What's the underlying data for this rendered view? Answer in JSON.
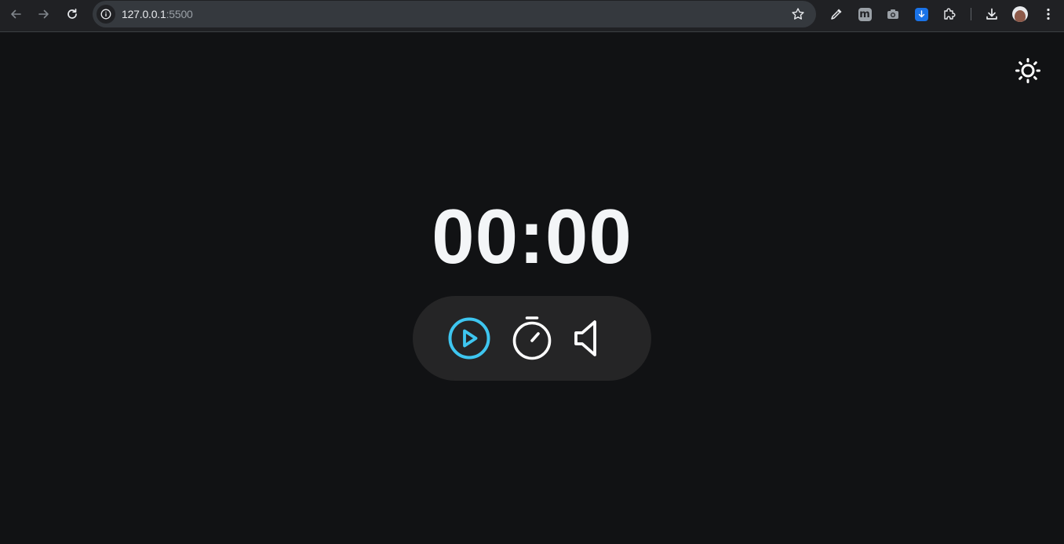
{
  "browser": {
    "url_host": "127.0.0.1",
    "url_port": ":5500",
    "icons": [
      "back-arrow-icon",
      "forward-arrow-icon",
      "reload-icon",
      "site-info-icon",
      "bookmark-star-icon",
      "eyedropper-extension-icon",
      "m-extension-icon",
      "camera-extension-icon",
      "download-extension-icon",
      "extensions-puzzle-icon",
      "downloads-icon",
      "profile-avatar",
      "menu-kebab-icon"
    ],
    "ext_m_letter": "m"
  },
  "app": {
    "timer": "00:00",
    "theme_icon": "sun-icon",
    "controls": [
      "play-icon",
      "stopwatch-icon",
      "volume-icon"
    ],
    "colors": {
      "background": "#111214",
      "panel": "#252526",
      "accent": "#3ec6f0",
      "text": "#f3f5f7"
    }
  }
}
